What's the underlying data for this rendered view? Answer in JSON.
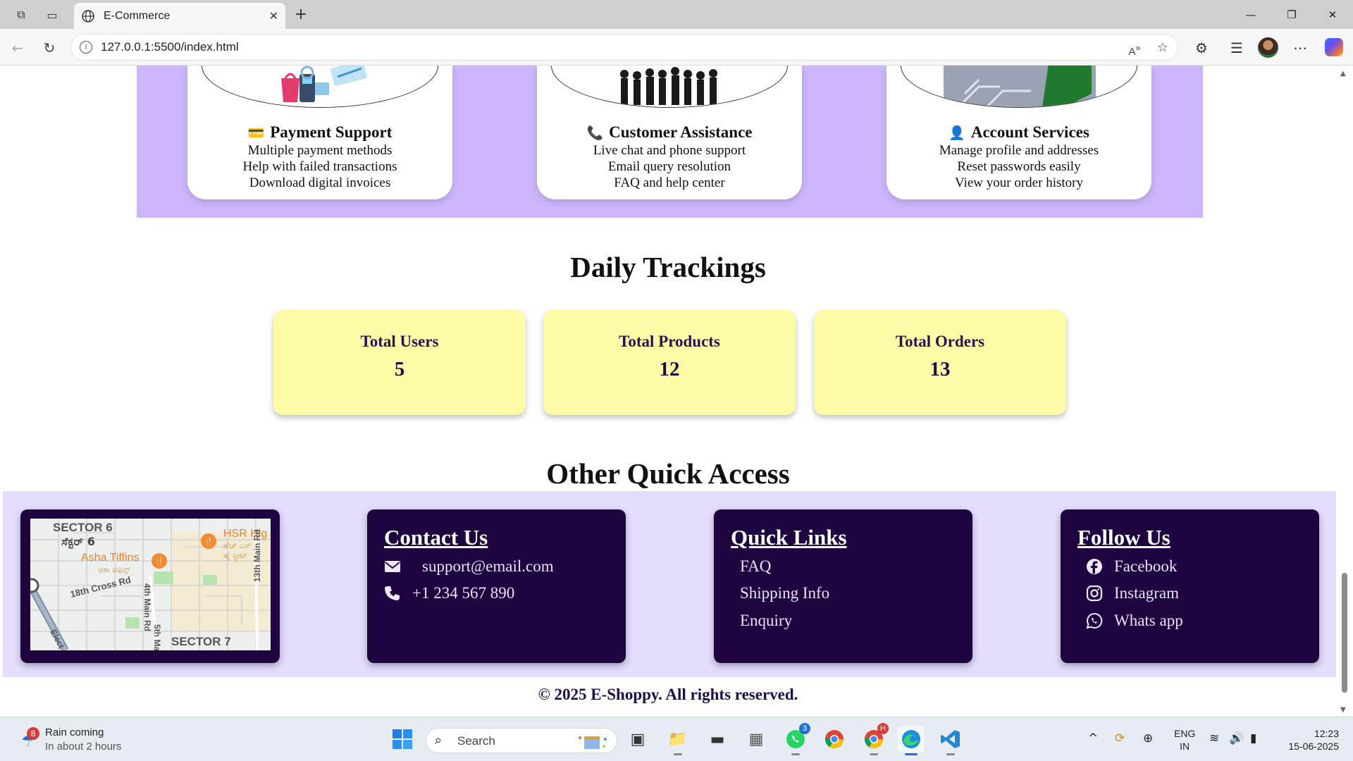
{
  "browser": {
    "tab_title": "E-Commerce",
    "url": "127.0.0.1:5500/index.html"
  },
  "services": [
    {
      "emoji": "💳",
      "title": "Payment Support",
      "lines": [
        "Multiple payment methods",
        "Help with failed transactions",
        "Download digital invoices"
      ]
    },
    {
      "emoji": "📞",
      "title": "Customer Assistance",
      "lines": [
        "Live chat and phone support",
        "Email query resolution",
        "FAQ and help center"
      ]
    },
    {
      "emoji": "👤",
      "title": "Account Services",
      "lines": [
        "Manage profile and addresses",
        "Reset passwords easily",
        "View your order history"
      ]
    }
  ],
  "tracking": {
    "heading": "Daily Trackings",
    "cards": [
      {
        "label": "Total Users",
        "value": "5"
      },
      {
        "label": "Total Products",
        "value": "12"
      },
      {
        "label": "Total Orders",
        "value": "13"
      }
    ]
  },
  "quick_access": {
    "heading": "Other Quick Access",
    "map_labels": [
      "SECTOR 6",
      "ಸೆಕ್ಟರ್ 6",
      "Asha Tiffins",
      "ಆಶಾ ಟಿಫಿನ್ಸ್",
      "HSR Hig",
      "ಹೆಚ್ ಎಸ್",
      "ಹೈ ಸ್ಟ್ರೀಟ್",
      "18th Cross Rd",
      "4th Main Rd",
      "5th Ma",
      "13th Main Rd",
      "SECTOR 7",
      "Elect"
    ],
    "contact": {
      "title": "Contact Us",
      "email": "support@email.com",
      "phone": "+1 234 567 890"
    },
    "links": {
      "title": "Quick Links",
      "items": [
        "FAQ",
        "Shipping Info",
        "Enquiry"
      ]
    },
    "follow": {
      "title": "Follow Us",
      "items": [
        "Facebook",
        "Instagram",
        "Whats app"
      ]
    }
  },
  "copyright": "© 2025 E-Shoppy. All rights reserved.",
  "taskbar": {
    "weather_title": "Rain coming",
    "weather_sub": "In about 2 hours",
    "weather_badge": "8",
    "search_placeholder": "Search",
    "whatsapp_badge": "3",
    "chrome_profile_badge": "H",
    "lang_1": "ENG",
    "lang_2": "IN",
    "time": "12:23",
    "date": "15-06-2025"
  }
}
